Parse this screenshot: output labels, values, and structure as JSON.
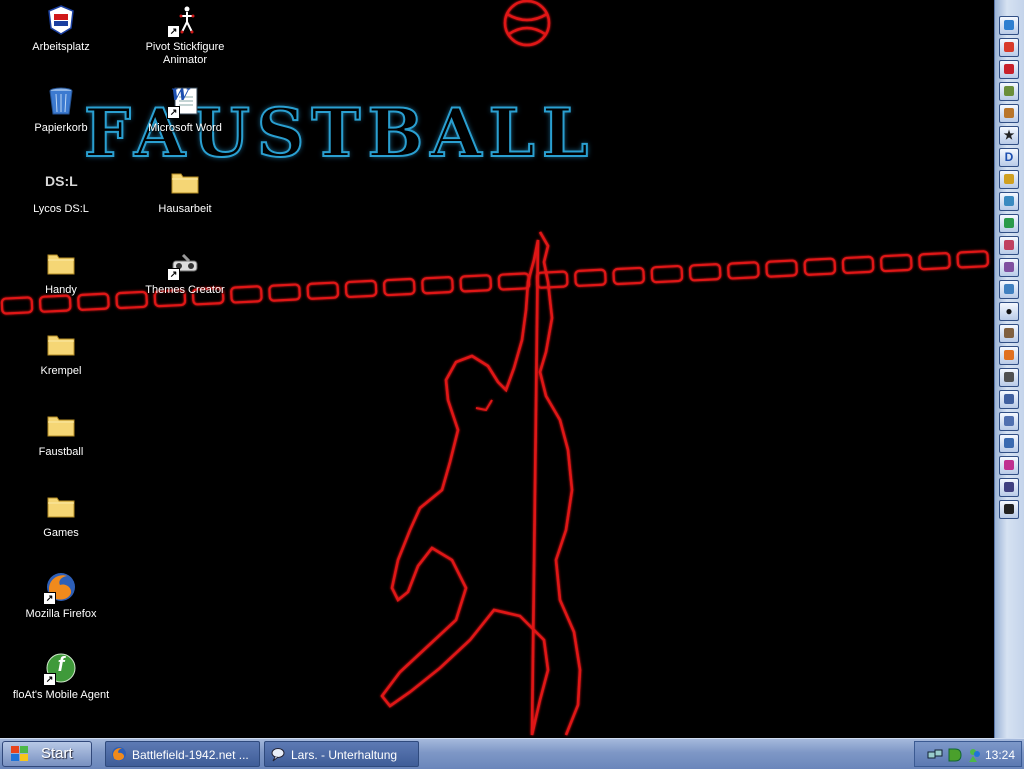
{
  "desktop": {
    "wallpaper_text": "FAUSTBALL",
    "icons": [
      {
        "label": "Arbeitsplatz",
        "icon": "my-computer-icon"
      },
      {
        "label": "Papierkorb",
        "icon": "recycle-bin-icon"
      },
      {
        "label": "Lycos DS:L",
        "icon": "lycos-dsl-icon",
        "glyph_text": "DS:L"
      },
      {
        "label": "Handy",
        "icon": "folder-icon"
      },
      {
        "label": "Krempel",
        "icon": "folder-icon"
      },
      {
        "label": "Faustball",
        "icon": "folder-icon"
      },
      {
        "label": "Games",
        "icon": "folder-icon"
      },
      {
        "label": "Mozilla Firefox",
        "icon": "firefox-icon"
      },
      {
        "label": "floAt's Mobile Agent",
        "icon": "float-agent-icon",
        "glyph_text": "f"
      },
      {
        "label": "Pivot Stickfigure Animator",
        "icon": "pivot-icon"
      },
      {
        "label": "Microsoft Word",
        "icon": "word-icon",
        "glyph_text": "W"
      },
      {
        "label": "Hausarbeit",
        "icon": "folder-icon"
      },
      {
        "label": "Themes Creator",
        "icon": "themes-creator-icon"
      }
    ]
  },
  "quicklaunch": {
    "items": [
      {
        "icon": "app-icon-1"
      },
      {
        "icon": "app-icon-2"
      },
      {
        "icon": "app-icon-3"
      },
      {
        "icon": "app-icon-4"
      },
      {
        "icon": "app-icon-5"
      },
      {
        "icon": "star-icon",
        "glyph": "★"
      },
      {
        "icon": "d-icon",
        "glyph": "D"
      },
      {
        "icon": "app-icon-8"
      },
      {
        "icon": "app-icon-9"
      },
      {
        "icon": "app-icon-10"
      },
      {
        "icon": "app-icon-11"
      },
      {
        "icon": "app-icon-12"
      },
      {
        "icon": "app-icon-13"
      },
      {
        "icon": "ball-icon",
        "glyph": "●"
      },
      {
        "icon": "app-icon-15"
      },
      {
        "icon": "app-icon-16"
      },
      {
        "icon": "app-icon-17"
      },
      {
        "icon": "user-icon"
      },
      {
        "icon": "app-icon-19"
      },
      {
        "icon": "app-icon-20"
      },
      {
        "icon": "palette-icon"
      },
      {
        "icon": "app-icon-22"
      },
      {
        "icon": "stick-figure-icon"
      }
    ]
  },
  "taskbar": {
    "start_label": "Start",
    "tasks": [
      {
        "label": "Battlefield-1942.net ...",
        "icon": "firefox-icon"
      },
      {
        "label": "Lars. - Unterhaltung",
        "icon": "messenger-icon"
      }
    ],
    "clock": "13:24"
  },
  "colors": {
    "wallpaper_red": "#e01818",
    "wallpaper_blue": "#2a9fd0",
    "taskbar": "#7e97c6"
  }
}
